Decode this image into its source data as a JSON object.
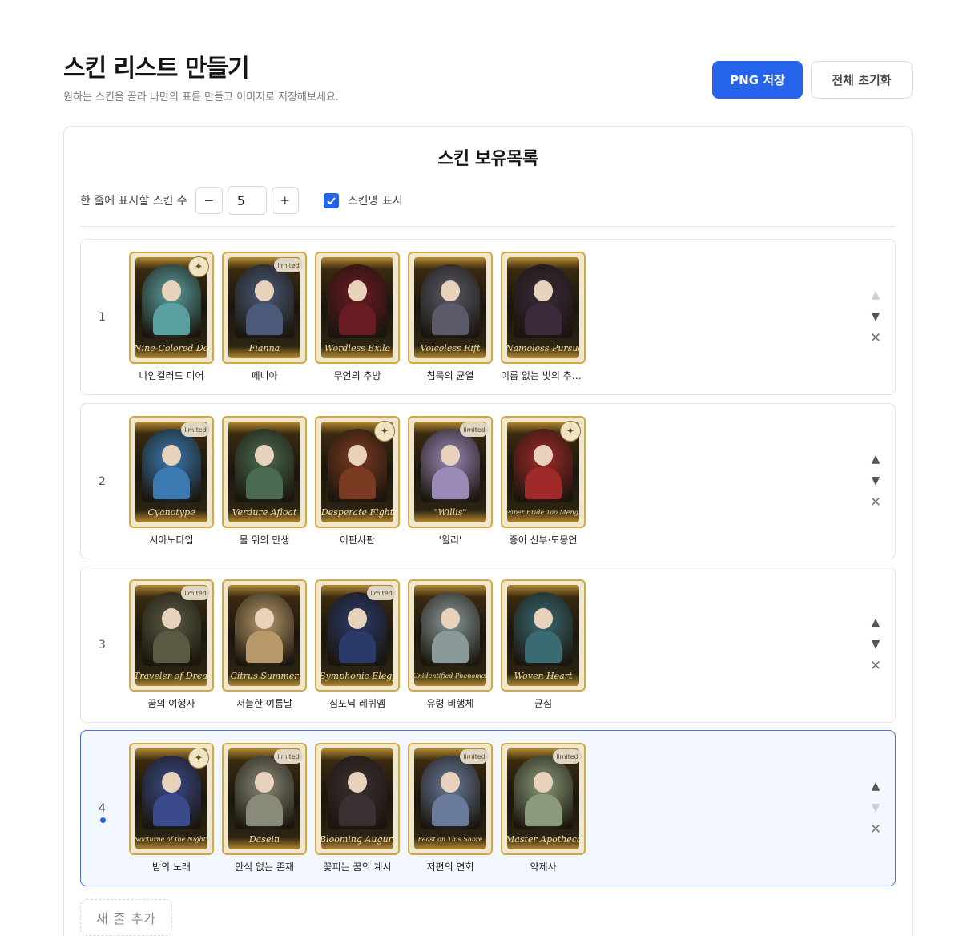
{
  "header": {
    "title": "스킨 리스트 만들기",
    "subtitle": "원하는 스킨을 골라 나만의 표를 만들고 이미지로 저장해보세요.",
    "png_button": "PNG 저장",
    "reset_button": "전체 초기화"
  },
  "panel": {
    "title": "스킨 보유목록",
    "per_row_label": "한 줄에 표시할 스킨 수",
    "per_row_value": "5",
    "minus_label": "−",
    "plus_label": "+",
    "show_names_label": "스킨명 표시",
    "show_names_checked": true,
    "add_row_label": "새 줄 추가"
  },
  "rows": [
    {
      "number": "1",
      "skins": [
        {
          "card_name": "Nine-Colored Deer",
          "label": "나인컬러드 디어",
          "badge": "icon",
          "art": "#5aa0a0"
        },
        {
          "card_name": "Fianna",
          "label": "페니아",
          "badge": "limited",
          "art": "#4a5a78"
        },
        {
          "card_name": "Wordless Exile",
          "label": "무언의 추방",
          "badge": "",
          "art": "#6a1a22"
        },
        {
          "card_name": "Voiceless Rift",
          "label": "침묵의 균열",
          "badge": "",
          "art": "#5a5a68"
        },
        {
          "card_name": "Nameless Pursuer",
          "label": "이름 없는 빛의 추적자",
          "badge": "",
          "art": "#3a2a3a"
        }
      ]
    },
    {
      "number": "2",
      "skins": [
        {
          "card_name": "Cyanotype",
          "label": "시아노타입",
          "badge": "limited",
          "art": "#3a7ab0"
        },
        {
          "card_name": "Verdure Afloat",
          "label": "물 위의 만생",
          "badge": "",
          "art": "#4a6a52"
        },
        {
          "card_name": "Desperate Fight",
          "label": "이판사판",
          "badge": "icon",
          "art": "#7a3a22"
        },
        {
          "card_name": "\"Willis\"",
          "label": "'윌리'",
          "badge": "limited",
          "art": "#9a8ab8"
        },
        {
          "card_name": "Paper Bride Tao Meng...",
          "label": "종이 신부·도몽언",
          "badge": "icon",
          "art": "#a02a2a"
        }
      ]
    },
    {
      "number": "3",
      "skins": [
        {
          "card_name": "Traveler of Dreams",
          "label": "꿈의 여행자",
          "badge": "limited",
          "art": "#5a5a42"
        },
        {
          "card_name": "Citrus Summer",
          "label": "서늘한 여름날",
          "badge": "",
          "art": "#b89a6a"
        },
        {
          "card_name": "Symphonic Elegy",
          "label": "심포닉 레퀴엠",
          "badge": "limited",
          "art": "#2a3a6a"
        },
        {
          "card_name": "Unidentified Phenomena",
          "label": "유령 비행체",
          "badge": "",
          "art": "#8a9a9a"
        },
        {
          "card_name": "Woven Heart",
          "label": "균심",
          "badge": "",
          "art": "#3a6a72"
        }
      ]
    },
    {
      "number": "4",
      "skins": [
        {
          "card_name": "Nocturne of the Night's...",
          "label": "밤의 노래",
          "badge": "icon",
          "art": "#3a4a8a"
        },
        {
          "card_name": "Dasein",
          "label": "안식 없는 존재",
          "badge": "limited",
          "art": "#8a8a78"
        },
        {
          "card_name": "Blooming Augury",
          "label": "꽃피는 꿈의 계시",
          "badge": "",
          "art": "#3a3032"
        },
        {
          "card_name": "Feast on This Shore",
          "label": "저편의 연회",
          "badge": "limited",
          "art": "#6a7a9a"
        },
        {
          "card_name": "Master Apothecary",
          "label": "약제사",
          "badge": "limited",
          "art": "#8a9a7a"
        }
      ]
    }
  ],
  "row_controls": {
    "up": "▲",
    "down": "▼",
    "remove": "✕",
    "limited_badge": "limited"
  }
}
